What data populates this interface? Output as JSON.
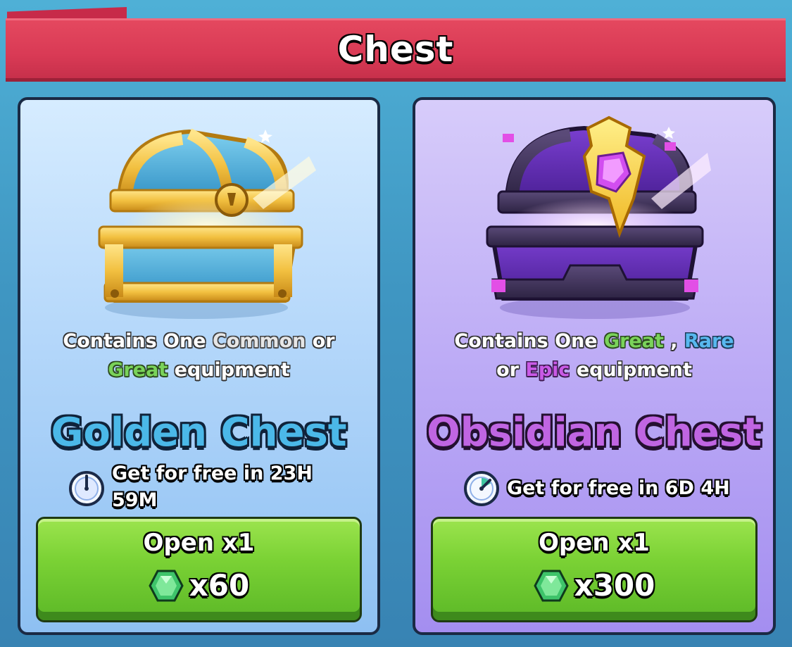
{
  "header": {
    "title": "Chest"
  },
  "golden": {
    "desc_line1_prefix": "Contains One ",
    "rarity_common": "Common",
    "desc_or": " or",
    "rarity_great": "Great",
    "desc_suffix": " equipment",
    "name": "Golden Chest",
    "timer_line1": "Get for free in 23H",
    "timer_line2": "59M",
    "open_label": "Open x1",
    "price": "x60"
  },
  "obsidian": {
    "desc_line1_prefix": "Contains One ",
    "rarity_great": "Great",
    "comma": " , ",
    "rarity_rare": "Rare",
    "desc_or": "or ",
    "rarity_epic": "Epic",
    "desc_suffix": " equipment",
    "name": "Obsidian Chest",
    "timer": "Get for free in 6D 4H",
    "open_label": "Open x1",
    "price": "x300"
  },
  "colors": {
    "banner": "#d93a55",
    "golden_name": "#4bb8e8",
    "obsidian_name": "#c065e2",
    "great": "#7ad35a",
    "rare": "#58b8ef",
    "epic": "#c95ae6",
    "button": "#7bd235"
  },
  "icons": [
    "golden-chest-icon",
    "obsidian-chest-icon",
    "clock-icon",
    "gem-icon"
  ]
}
